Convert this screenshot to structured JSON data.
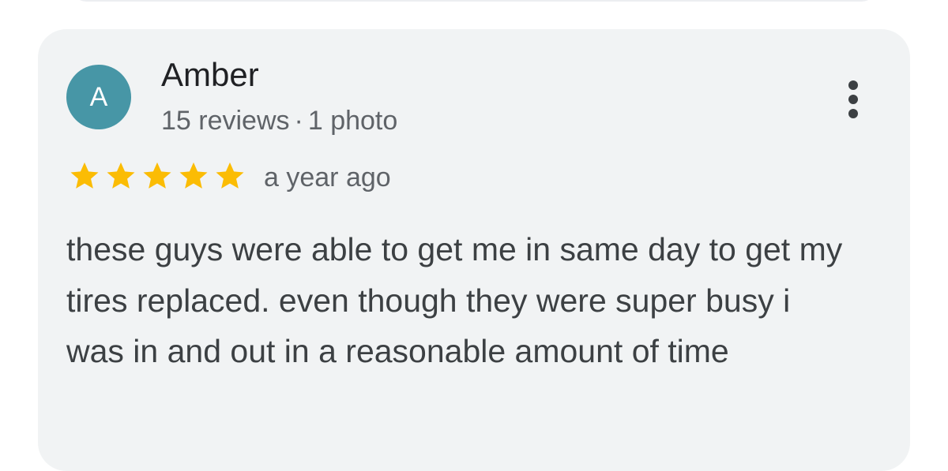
{
  "review": {
    "author_initial": "A",
    "author_name": "Amber",
    "author_reviews": "15 reviews",
    "separator": "·",
    "author_photos": "1 photo",
    "rating": 5,
    "rating_max": 5,
    "time_ago": "a year ago",
    "text": "these guys were able to get me in same day to get my tires replaced. even though they were super busy i was in and out in a reasonable amount of time",
    "more_options_icon": "more-vertical-icon",
    "star_icon": "star-icon"
  },
  "colors": {
    "avatar_bg": "#4796a6",
    "card_bg": "#f1f3f4",
    "star": "#fbbc04"
  }
}
